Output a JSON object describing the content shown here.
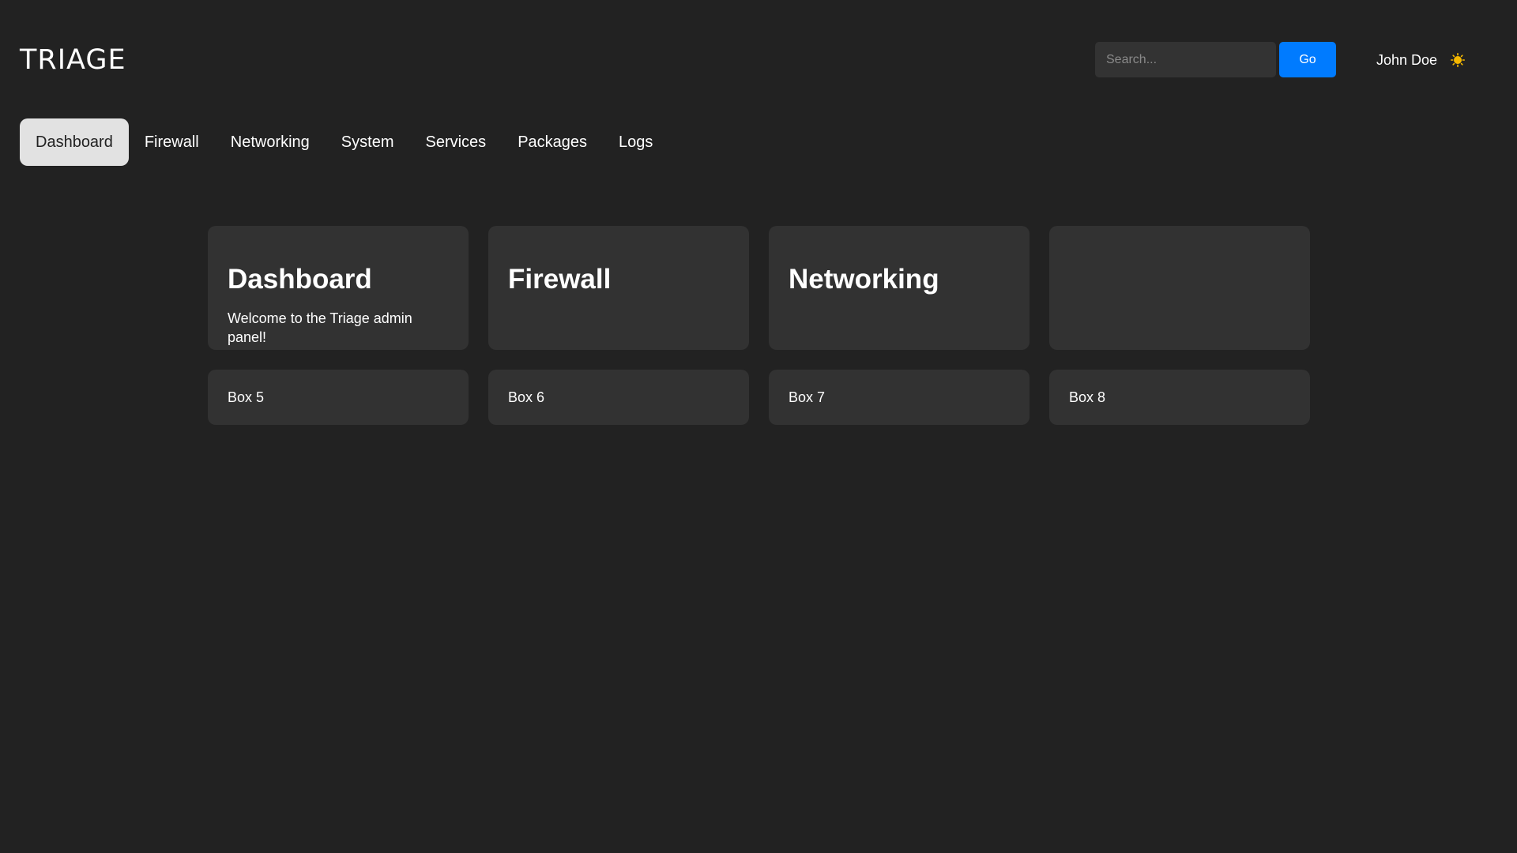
{
  "header": {
    "logo": "TRIAGE",
    "search": {
      "placeholder": "Search...",
      "value": ""
    },
    "go_label": "Go",
    "user_name": "John Doe",
    "theme_icon": "sun-icon",
    "accent_color": "#007bff"
  },
  "nav": {
    "items": [
      {
        "label": "Dashboard",
        "active": true
      },
      {
        "label": "Firewall"
      },
      {
        "label": "Networking"
      },
      {
        "label": "System"
      },
      {
        "label": "Services"
      },
      {
        "label": "Packages"
      },
      {
        "label": "Logs"
      }
    ]
  },
  "cards": [
    {
      "title": "Dashboard",
      "text": "Welcome to the Triage admin panel!"
    },
    {
      "title": "Firewall",
      "text": ""
    },
    {
      "title": "Networking",
      "text": ""
    },
    {
      "title": "",
      "text": ""
    }
  ],
  "boxes": [
    {
      "label": "Box 5"
    },
    {
      "label": "Box 6"
    },
    {
      "label": "Box 7"
    },
    {
      "label": "Box 8"
    }
  ]
}
